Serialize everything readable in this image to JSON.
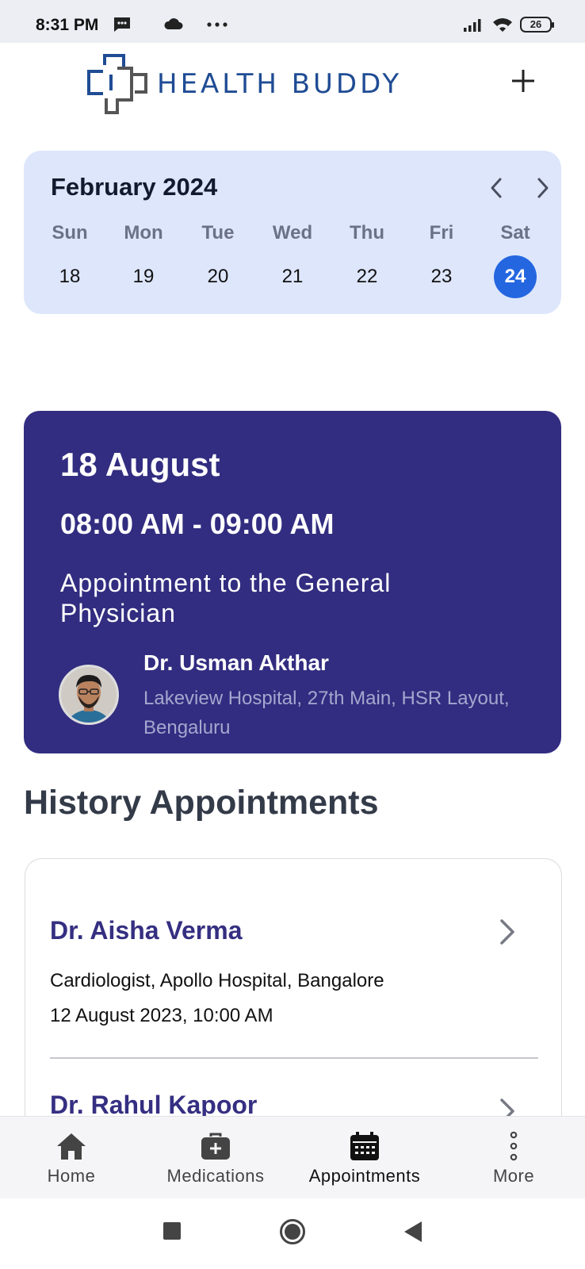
{
  "status_bar": {
    "time": "8:31 PM",
    "battery": "26"
  },
  "header": {
    "app_name": "HEALTH BUDDY",
    "add_icon": "plus-icon",
    "logo_colors": [
      "#1f4c94",
      "#555555"
    ]
  },
  "calendar": {
    "month_label": "February 2024",
    "weekdays": [
      "Sun",
      "Mon",
      "Tue",
      "Wed",
      "Thu",
      "Fri",
      "Sat"
    ],
    "dates": [
      "18",
      "19",
      "20",
      "21",
      "22",
      "23",
      "24"
    ],
    "selected_date": "24",
    "accent": "#2466e0"
  },
  "upcoming": {
    "date": "18 August",
    "time": "08:00 AM - 09:00 AM",
    "title": "Appointment to the General Physician",
    "doctor_name": "Dr. Usman Akthar",
    "address": "Lakeview Hospital, 27th Main, HSR Layout, Bengaluru",
    "card_color": "#322d80"
  },
  "history": {
    "title": "History Appointments",
    "items": [
      {
        "doctor": "Dr. Aisha Verma",
        "specialty": "Cardiologist, Apollo Hospital, Bangalore",
        "datetime": "12 August 2023, 10:00 AM"
      },
      {
        "doctor": "Dr. Rahul Kapoor"
      }
    ]
  },
  "bottom_nav": {
    "items": [
      {
        "label": "Home",
        "icon": "home-icon"
      },
      {
        "label": "Medications",
        "icon": "medical-bag-icon"
      },
      {
        "label": "Appointments",
        "icon": "calendar-icon",
        "active": true
      },
      {
        "label": "More",
        "icon": "more-vertical-icon"
      }
    ]
  }
}
